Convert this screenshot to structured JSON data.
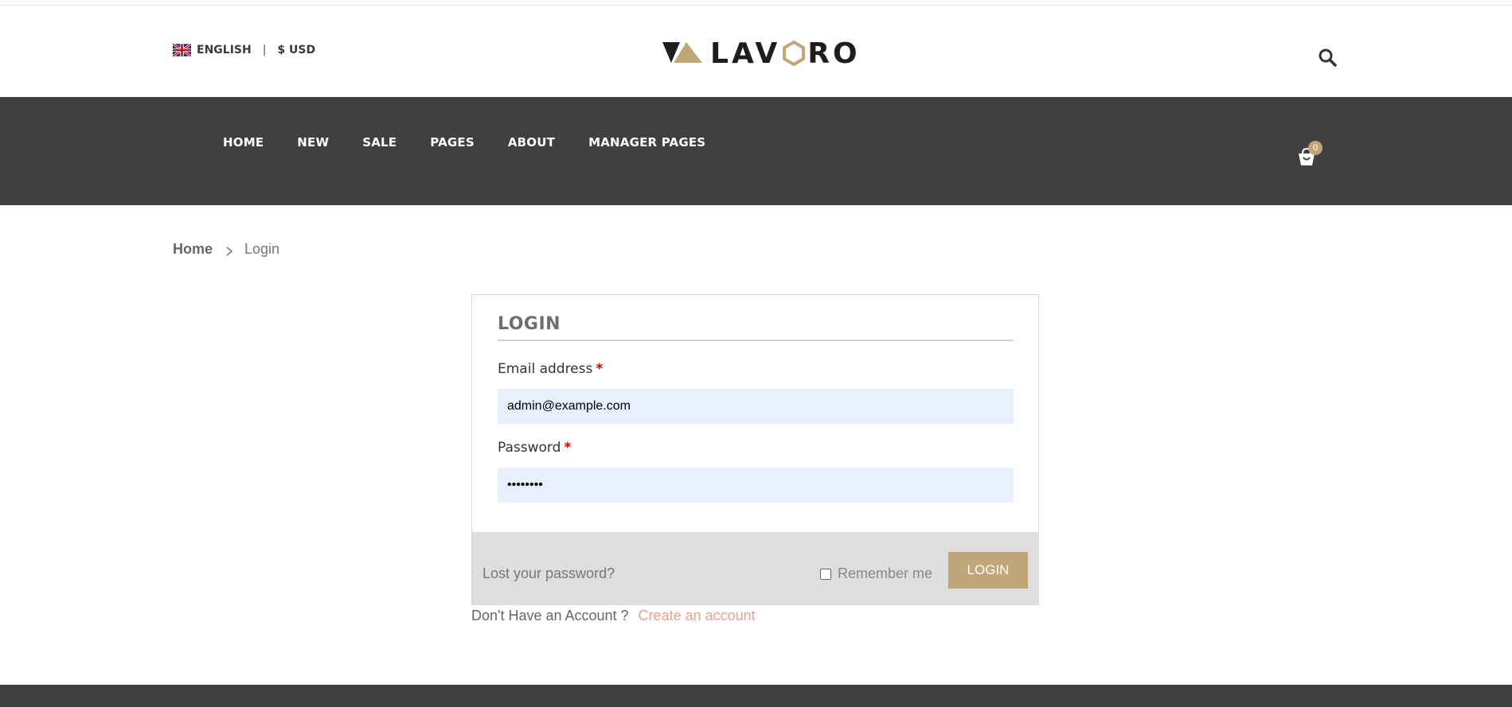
{
  "header": {
    "language": "ENGLISH",
    "separator": "|",
    "currency": "$ USD",
    "logo_text": "LAV",
    "logo_text_end": "RO",
    "search_icon": "search-icon"
  },
  "nav": {
    "items": [
      "HOME",
      "NEW",
      "SALE",
      "PAGES",
      "ABOUT",
      "MANAGER PAGES"
    ],
    "cart_count": "0",
    "cart_icon": "cart-icon"
  },
  "breadcrumb": {
    "home": "Home",
    "current": "Login"
  },
  "login": {
    "title": "LOGIN",
    "email_label": "Email address",
    "email_value": "admin@example.com",
    "password_label": "Password",
    "password_value": "••••••••",
    "required_mark": "*",
    "lost_password": "Lost your password?",
    "remember_me": "Remember me",
    "login_button": "LOGIN"
  },
  "account": {
    "prompt": "Don't Have an Account ?",
    "create_link": "Create an account"
  },
  "colors": {
    "accent": "#c0a679",
    "nav_bg": "#404040",
    "input_bg": "#e8f0fe",
    "link_pink": "#e8a08f"
  }
}
